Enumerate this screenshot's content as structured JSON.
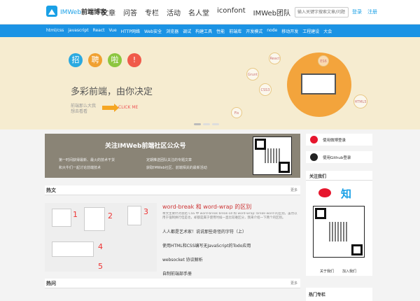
{
  "header": {
    "logo_prefix": "IMWeb",
    "logo_name": "前端博客",
    "nav": [
      "文章",
      "问答",
      "专栏",
      "活动",
      "名人堂",
      "iconfont",
      "IMWeb团队"
    ],
    "search_placeholder": "输入关键字搜索文章/问题",
    "login": "登录",
    "register": "注册"
  },
  "subnav": [
    "html/css",
    "javascript",
    "React",
    "Vue",
    "HTTP网络",
    "Web安全",
    "浏览器",
    "调试",
    "构建工具",
    "性能",
    "前端库",
    "开发模式",
    "node",
    "移动开发",
    "工程建设",
    "大会"
  ],
  "banner": {
    "recruit_chars": [
      "招",
      "聘",
      "啦",
      "!"
    ],
    "recruit_colors": [
      "#2aa9e0",
      "#f0a030",
      "#8cc63f",
      "#f05a4a"
    ],
    "slogan": "多彩前端，由你决定",
    "sub_text": "前端那么大我想去看看",
    "link": "CLICK ME",
    "bubbles": [
      "React",
      "ES6",
      "Grunt",
      "CSS3",
      "Fis",
      "HTML5"
    ]
  },
  "wechat": {
    "title": "关注IMWeb前端社区公众号",
    "points": [
      "第一时间获得最新、最火的技术干货",
      "定期推送团队关注的专题文章",
      "和大牛们一起讨论前端技术",
      "获取IMWeb社区、前端相关的最新活动"
    ]
  },
  "hot": {
    "title": "热文",
    "more": "更多",
    "image_numbers": [
      "1",
      "2",
      "3",
      "4",
      "5"
    ],
    "lead_title": "word-break 和 word-wrap 的区别",
    "lead_desc": "本文主要针对总结 CSS 中 word-break break-all 和 word-wrap: break-word 的区别，虽然以用于强制换行但是也，却都是属于使用时候一直比较难区分，我来介绍一下两个的区别。",
    "items": [
      "人人都是艺术家！说说那些奇怪的字符（上）",
      "使用HTML和CSS编写无JavaScript的Todo应用",
      "websocket 协议解析",
      "自制前端部手册"
    ]
  },
  "qa": {
    "title": "热问",
    "more": "更多"
  },
  "sidebar": {
    "weibo_login": "使用微博登录",
    "github_login": "使用Github登录",
    "follow_title": "关注我们",
    "zhi": "知",
    "about": "关于我们",
    "join": "加入我们",
    "hot_columns": "热门专栏"
  }
}
